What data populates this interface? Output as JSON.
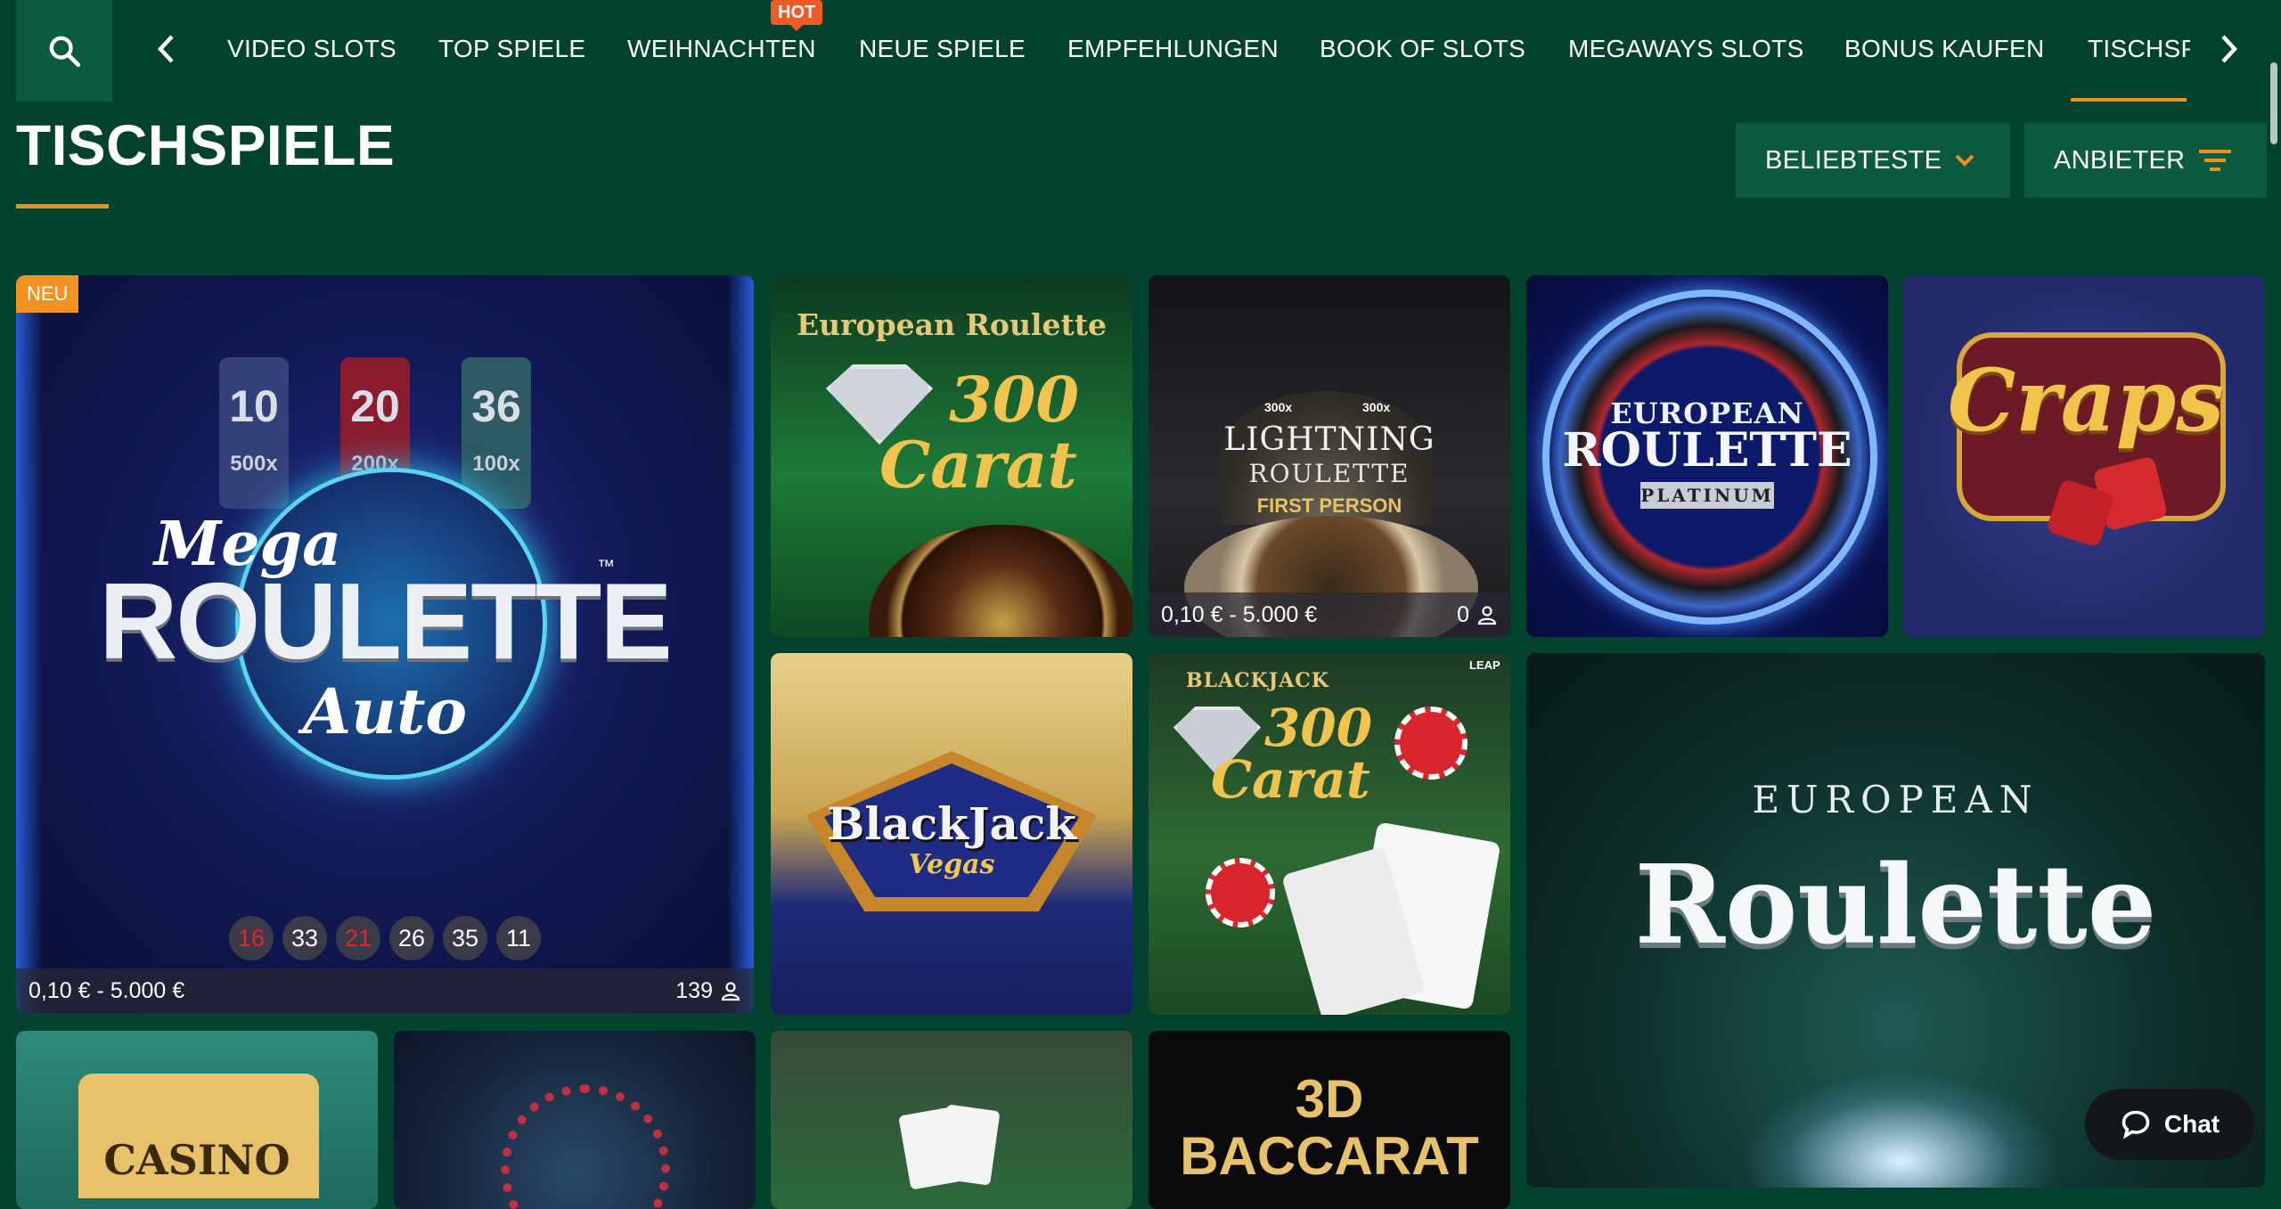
{
  "nav": {
    "items": [
      {
        "label": "VIDEO SLOTS"
      },
      {
        "label": "TOP SPIELE"
      },
      {
        "label": "WEIHNACHTEN",
        "badge": "HOT"
      },
      {
        "label": "NEUE SPIELE"
      },
      {
        "label": "EMPFEHLUNGEN"
      },
      {
        "label": "BOOK OF SLOTS"
      },
      {
        "label": "MEGAWAYS SLOTS"
      },
      {
        "label": "BONUS KAUFEN"
      },
      {
        "label": "TISCHSPIELE",
        "active": true
      }
    ],
    "active_color": "#f0901a",
    "badge_color": "#f05a24"
  },
  "page": {
    "title": "TISCHSPIELE",
    "sort_label": "BELIEBTESTE",
    "provider_label": "ANBIETER"
  },
  "games": {
    "mega": {
      "badge": "NEU",
      "multipliers": [
        "10",
        "20",
        "36"
      ],
      "multiplier_values": [
        "500x",
        "200x",
        "100x"
      ],
      "logo_top": "Mega",
      "logo_main": "ROULETTE",
      "logo_tm": "™",
      "logo_sub": "Auto",
      "results": [
        {
          "n": "16",
          "color": "red"
        },
        {
          "n": "33",
          "color": "black"
        },
        {
          "n": "21",
          "color": "red"
        },
        {
          "n": "26",
          "color": "black"
        },
        {
          "n": "35",
          "color": "black"
        },
        {
          "n": "11",
          "color": "black"
        }
      ],
      "limits": "0,10 € - 5.000 €",
      "players": "139"
    },
    "euro300": {
      "title": "European Roulette",
      "big": "300",
      "sub": "Carat"
    },
    "lightning": {
      "multipliers": [
        "300x",
        "300x"
      ],
      "title": "LIGHTNING",
      "title2": "ROULETTE",
      "sub": "FIRST PERSON",
      "limits": "0,10 € - 5.000 €",
      "players": "0"
    },
    "platinum": {
      "line1": "EUROPEAN",
      "line2": "ROULETTE",
      "line3": "PLATINUM"
    },
    "craps": {
      "title": "Craps"
    },
    "bjvegas": {
      "title": "BlackJack",
      "sub": "Vegas"
    },
    "bj300": {
      "label": "BLACKJACK",
      "big": "300",
      "sub": "Carat",
      "leap": "LEAP"
    },
    "european": {
      "line1": "EUROPEAN",
      "line2": "Roulette"
    },
    "casino": {
      "title": "CASINO"
    },
    "baccarat": {
      "line1": "3D",
      "line2": "BACCARAT"
    }
  },
  "chat": {
    "label": "Chat"
  },
  "icons": [
    "search-icon",
    "chevron-left-icon",
    "chevron-right-icon",
    "chevron-down-icon",
    "filter-icon",
    "user-icon",
    "chat-bubble-icon"
  ]
}
